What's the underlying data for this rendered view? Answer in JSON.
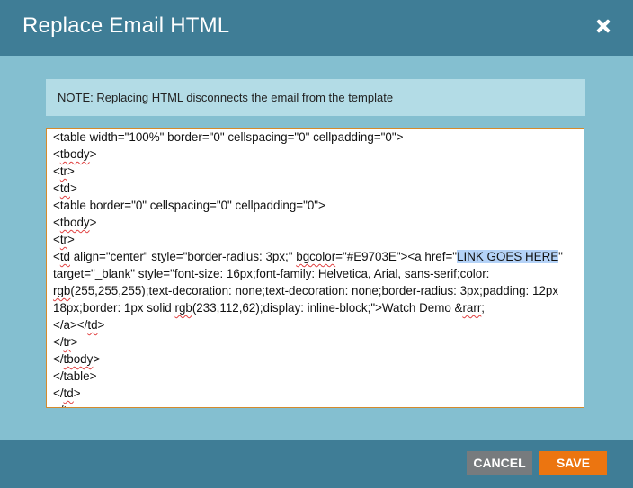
{
  "dialog": {
    "title": "Replace Email HTML",
    "close_icon": "close-icon",
    "note": "NOTE:  Replacing HTML disconnects the email from the template",
    "colors": {
      "header": "#3f7d96",
      "body": "#84bfd0",
      "note_bg": "#b3dce6",
      "save": "#ec7510",
      "cancel": "#777b7e"
    }
  },
  "editor": {
    "lines": [
      "<table width=\"100%\" border=\"0\" cellspacing=\"0\" cellpadding=\"0\">",
      "<tbody>",
      "<tr>",
      "<td>",
      "<table border=\"0\" cellspacing=\"0\" cellpadding=\"0\">",
      "<tbody>",
      "<tr>",
      "<td align=\"center\" style=\"border-radius: 3px;\" bgcolor=\"#E9703E\"><a href=\"LINK GOES HERE\" target=\"_blank\" style=\"font-size: 16px;font-family: Helvetica, Arial, sans-serif;color: rgb(255,255,255);text-decoration: none;text-decoration: none;border-radius: 3px;padding: 12px 18px;border: 1px solid rgb(233,112,62);display: inline-block;\">Watch Demo &rarr;",
      "</a></td>",
      "</tr>",
      "</tbody>",
      "</table>",
      "</td>",
      "</tr>"
    ],
    "highlighted_text": "LINK GOES HERE"
  },
  "footer": {
    "cancel_label": "CANCEL",
    "save_label": "SAVE"
  }
}
